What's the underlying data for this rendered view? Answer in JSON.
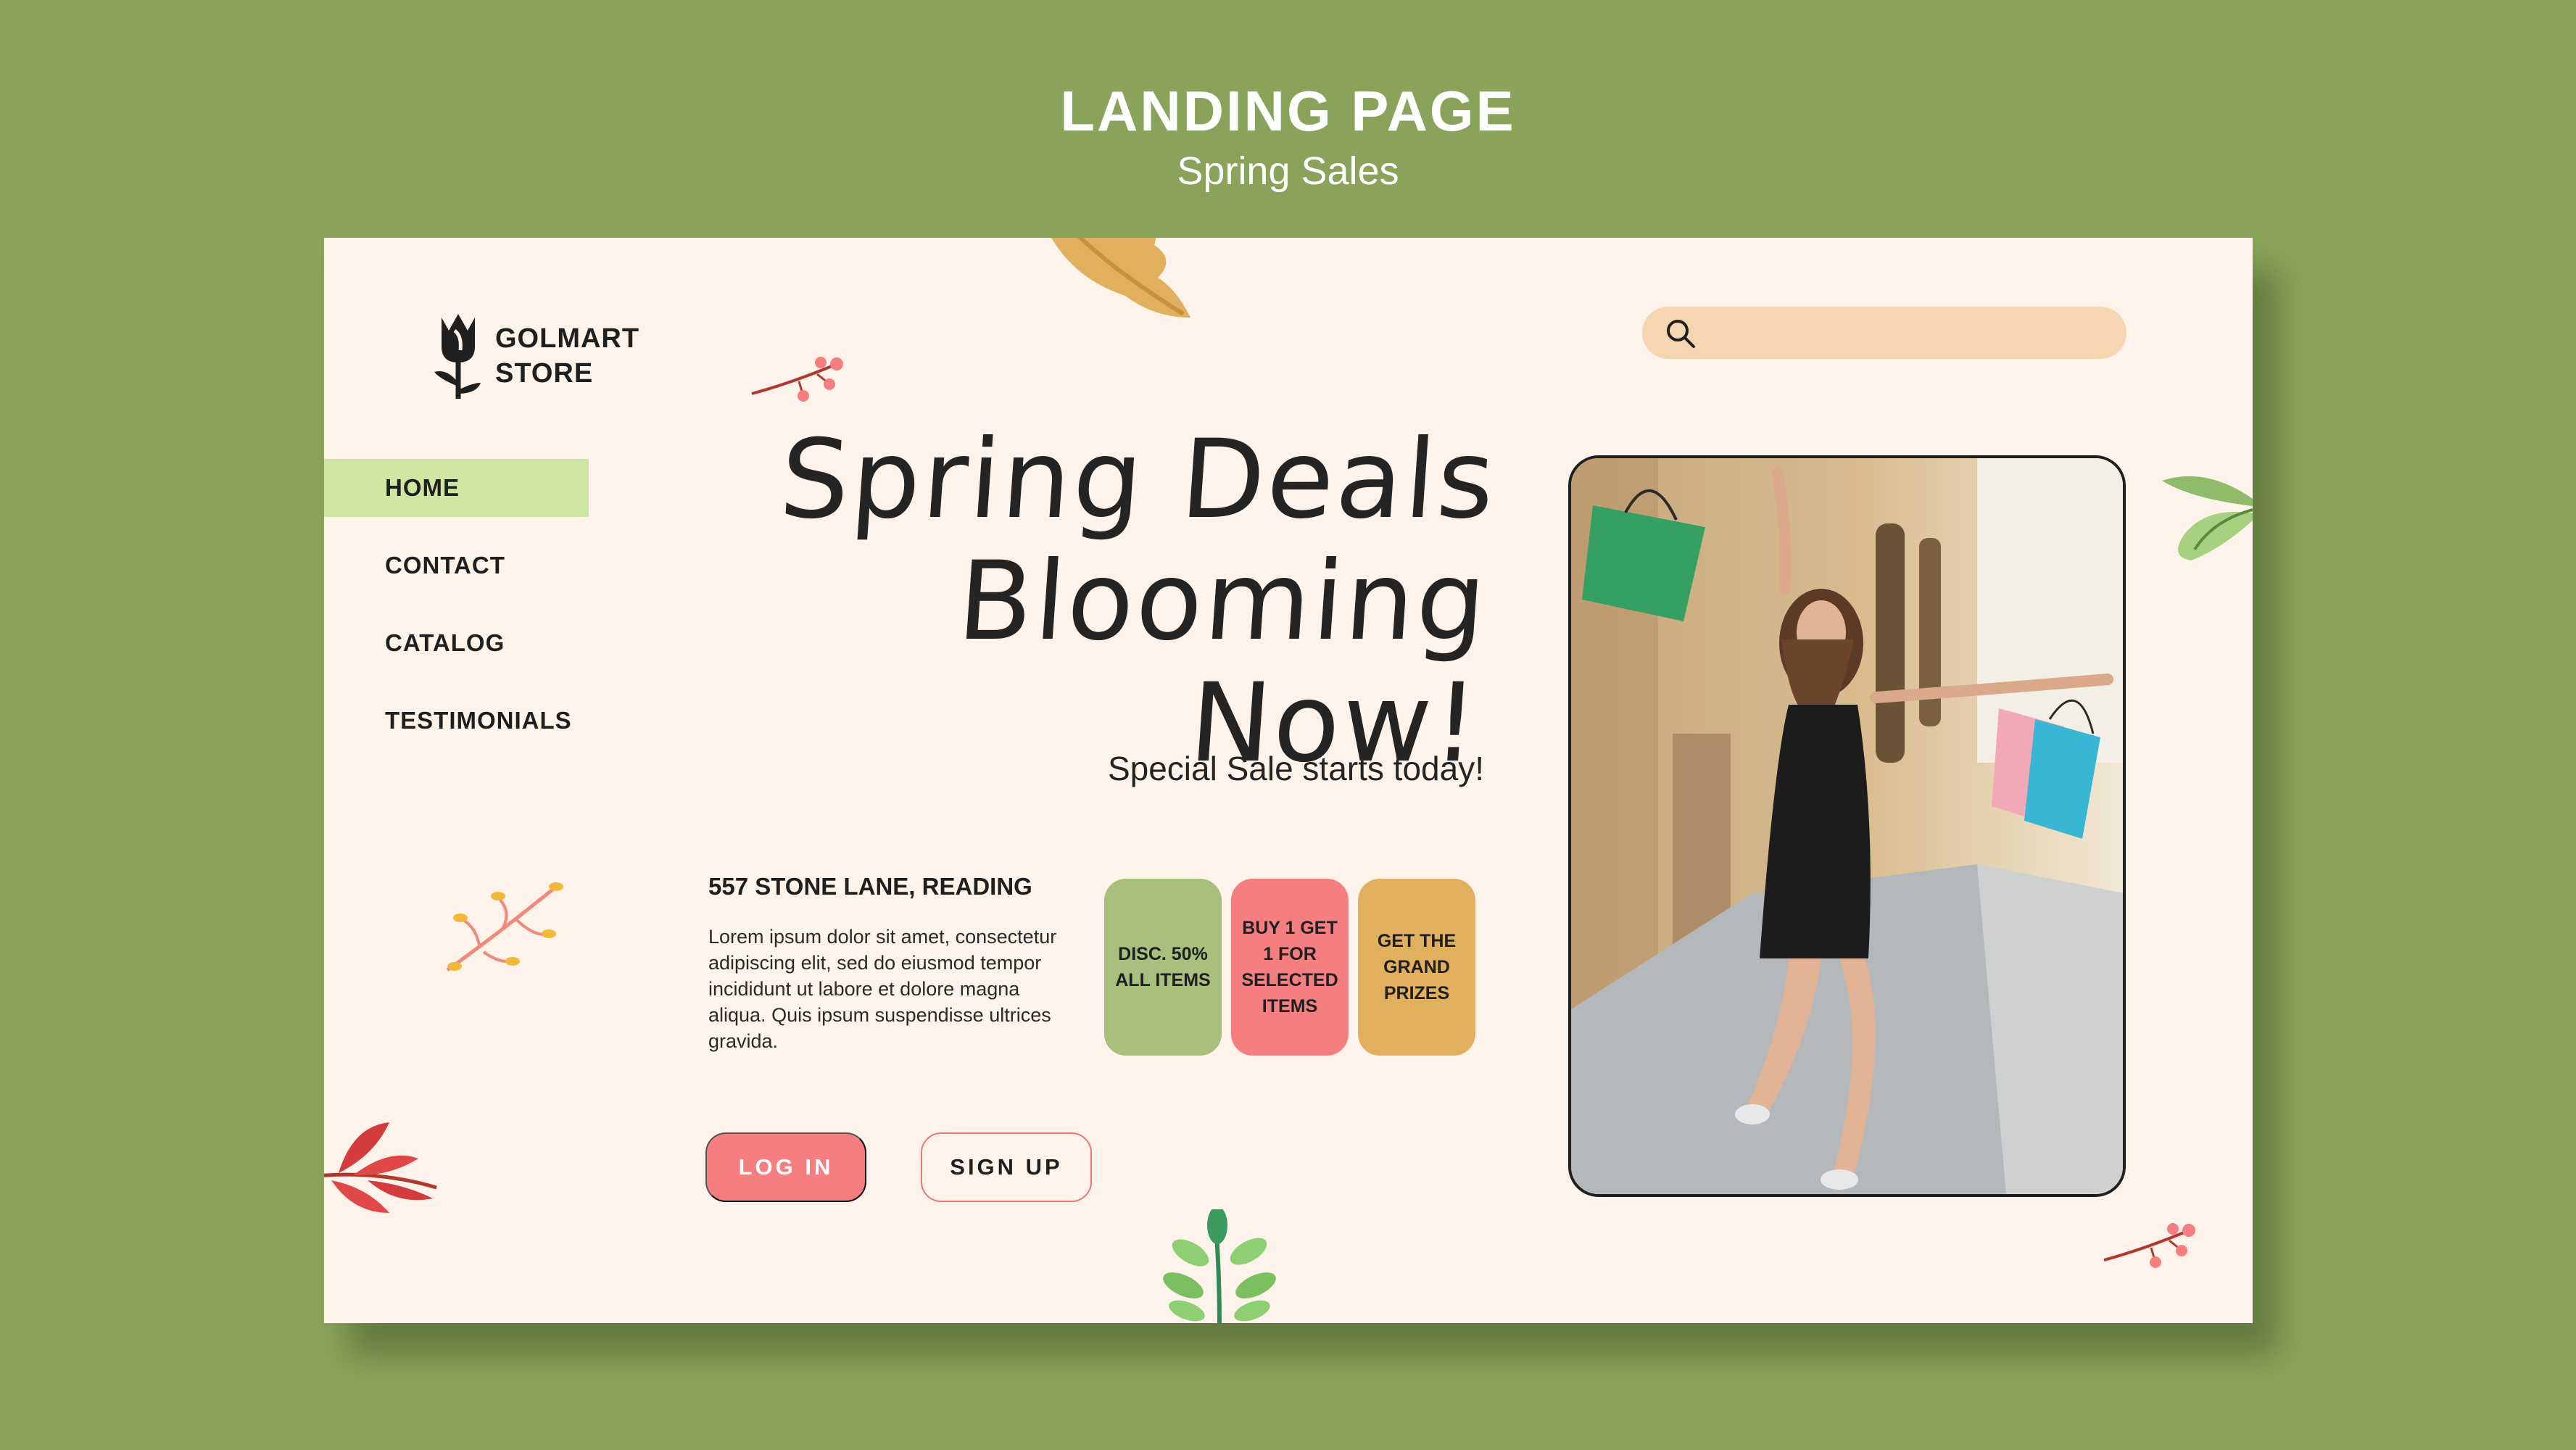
{
  "header": {
    "title": "LANDING PAGE",
    "subtitle": "Spring Sales"
  },
  "logo": {
    "line1": "GOLMART",
    "line2": "STORE"
  },
  "nav": {
    "items": [
      {
        "label": "HOME",
        "active": true
      },
      {
        "label": "CONTACT",
        "active": false
      },
      {
        "label": "CATALOG",
        "active": false
      },
      {
        "label": "TESTIMONIALS",
        "active": false
      }
    ]
  },
  "search": {
    "placeholder": "",
    "icon": "search-icon"
  },
  "hero": {
    "title_line1": "Spring Deals",
    "title_line2": "Blooming Now!",
    "subtitle": "Special Sale starts today!"
  },
  "info": {
    "address": "557 STONE LANE, READING",
    "description": "Lorem ipsum dolor sit amet, consectetur adipiscing elit, sed do eiusmod tempor incididunt ut labore et dolore magna aliqua. Quis ipsum suspendisse ultrices gravida."
  },
  "promos": [
    {
      "text": "DISC. 50% ALL ITEMS",
      "color": "#a8bf7d"
    },
    {
      "text": "BUY 1 GET 1 FOR SELECTED ITEMS",
      "color": "#f47e80"
    },
    {
      "text": "GET THE GRAND PRIZES",
      "color": "#e1b05f"
    }
  ],
  "buttons": {
    "login": "LOG IN",
    "signup": "SIGN UP"
  },
  "colors": {
    "background": "#8aa35a",
    "card": "#fdf3ea",
    "nav_active": "#cfe6a2",
    "search_bg": "#f5d6b1",
    "accent_pink": "#f47e80",
    "accent_green": "#a8bf7d",
    "accent_gold": "#e1b05f"
  }
}
